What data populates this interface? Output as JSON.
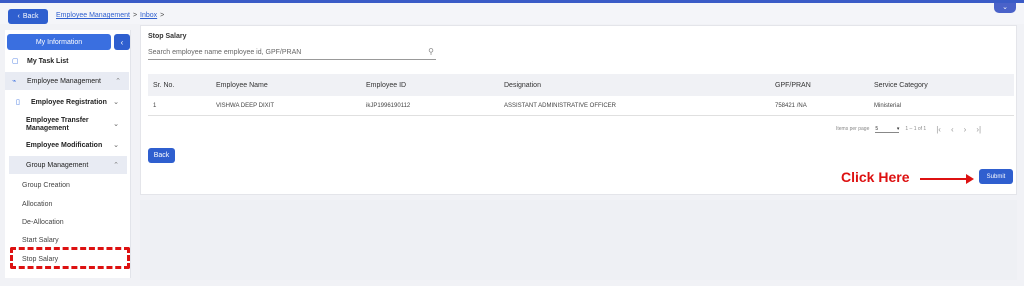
{
  "header": {
    "back_label": "Back",
    "breadcrumb": [
      "Employee Management",
      "Inbox"
    ],
    "breadcrumb_separator": ">"
  },
  "sidebar": {
    "my_information": "My Information",
    "my_task_list": "My Task List",
    "employee_management": "Employee Management",
    "employee_registration": "Employee Registration",
    "employee_transfer": "Employee Transfer Management",
    "employee_modification": "Employee Modification",
    "group_management": "Group Management",
    "group_items": [
      "Group Creation",
      "Allocation",
      "De-Allocation",
      "Start Salary",
      "Stop Salary"
    ]
  },
  "main": {
    "title": "Stop Salary",
    "search_placeholder": "Search employee name employee id, GPF/PRAN",
    "table": {
      "columns": [
        "Sr. No.",
        "Employee Name",
        "Employee ID",
        "Designation",
        "GPF/PRAN",
        "Service Category"
      ],
      "rows": [
        [
          "1",
          "VISHWA DEEP DIXIT",
          "ikJP1996190112",
          "ASSISTANT ADMINISTRATIVE OFFICER",
          "758421 /NA",
          "Ministerial"
        ]
      ]
    },
    "pagination": {
      "items_per_page_label": "Items per page",
      "items_per_page": "5",
      "range": "1 – 1 of 1"
    },
    "back_button": "Back",
    "submit_button": "Submit",
    "annotation": "Click Here"
  },
  "colors": {
    "primary": "#2f5fcf",
    "highlight": "#dd1111"
  }
}
